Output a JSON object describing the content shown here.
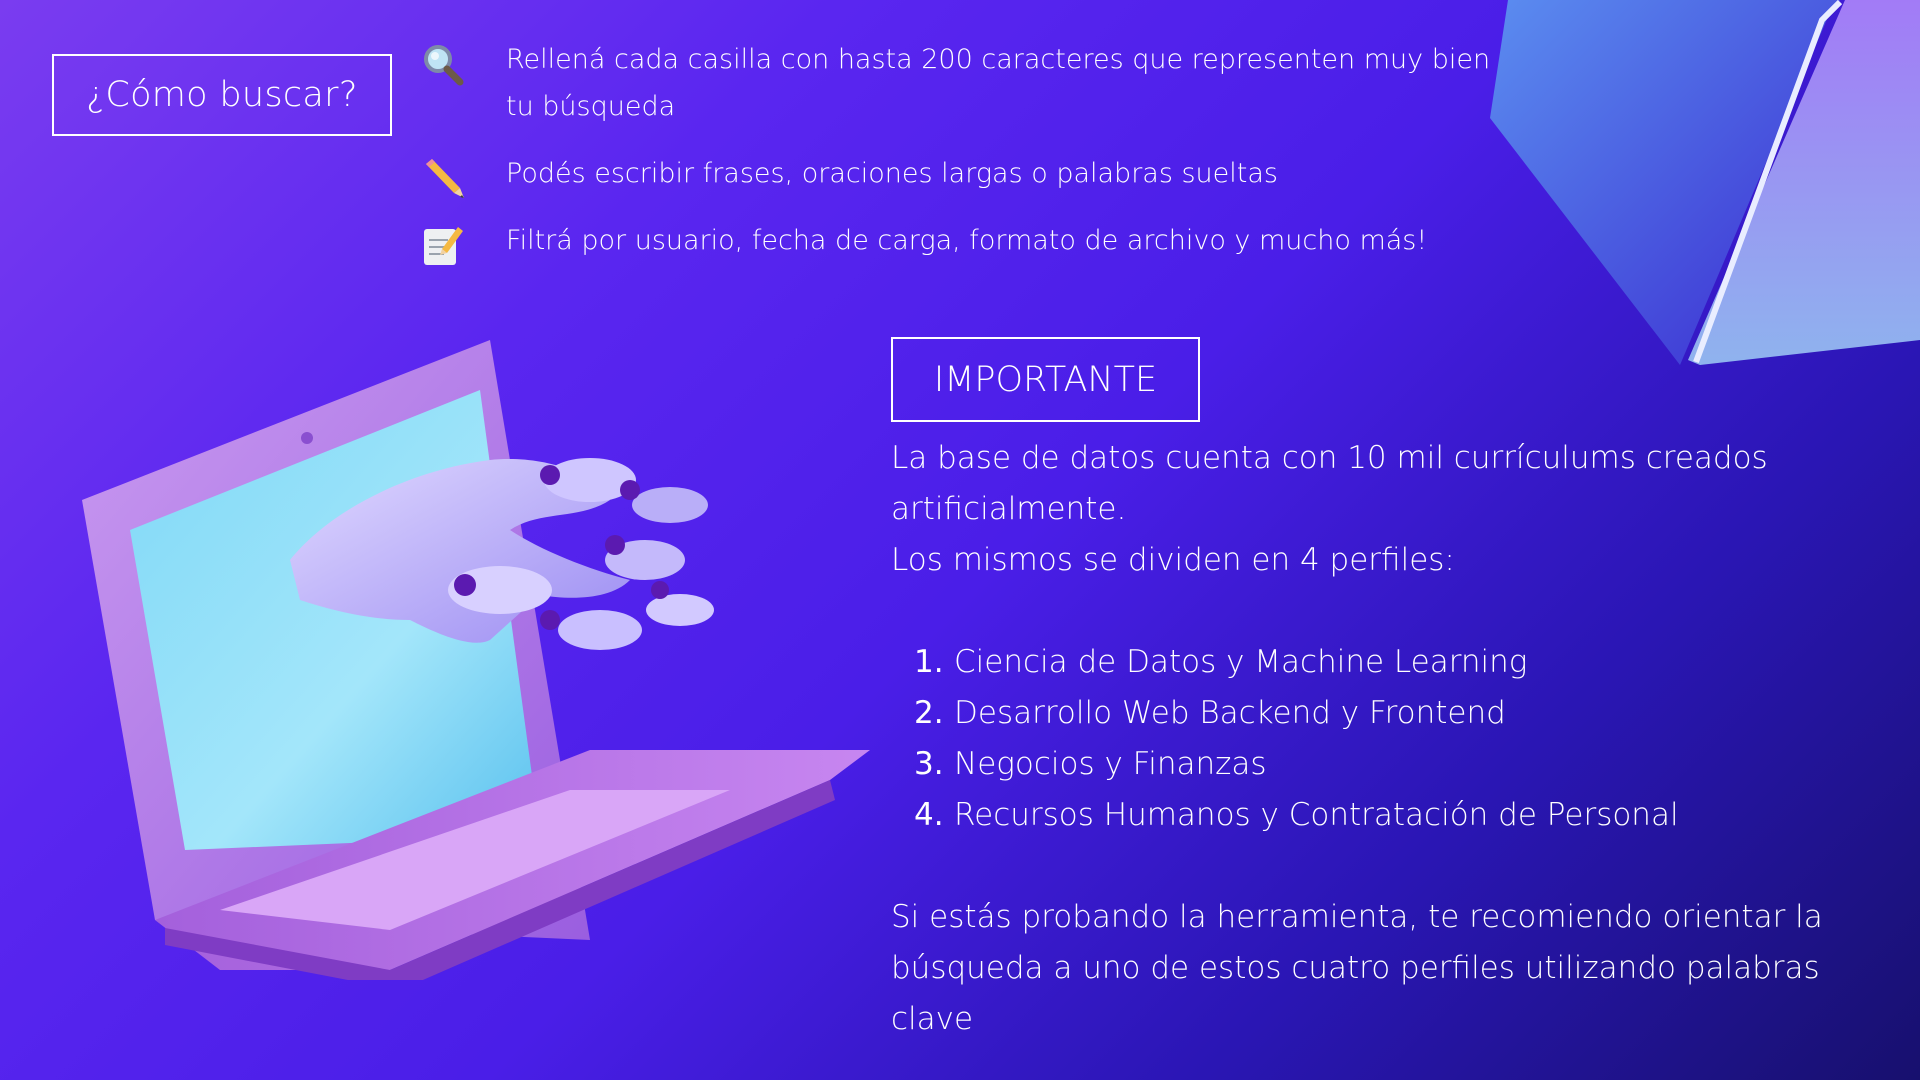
{
  "title": "¿Cómo buscar?",
  "tips": [
    {
      "icon": "magnifier-icon",
      "text": "Rellená cada casilla con hasta 200 caracteres que  representen muy bien tu búsqueda"
    },
    {
      "icon": "pencil-icon",
      "text": "Podés escribir frases, oraciones largas o palabras sueltas"
    },
    {
      "icon": "memo-icon",
      "text": "Filtrá por usuario, fecha de carga, formato de archivo y mucho más!"
    }
  ],
  "important": {
    "heading": "IMPORTANTE",
    "intro_line1": "La base de datos cuenta con 10 mil currículums creados artificialmente.",
    "intro_line2": "Los mismos se dividen en 4 perfiles:",
    "profiles": [
      "Ciencia de Datos y Machine Learning",
      "Desarrollo Web Backend y Frontend",
      "Negocios y Finanzas",
      "Recursos Humanos y Contratación de Personal"
    ],
    "recommendation": "Si estás probando la herramienta, te recomiendo orientar la búsqueda a uno de estos cuatro perfiles utilizando palabras clave"
  },
  "colors": {
    "bg_start": "#7a3cf0",
    "bg_end": "#17106e",
    "text": "#ffffff",
    "screen": "#7fd8f7",
    "laptop_body": "#b57be6"
  },
  "illustrations": [
    "laptop-robot-hand-illustration",
    "cube-decoration"
  ]
}
